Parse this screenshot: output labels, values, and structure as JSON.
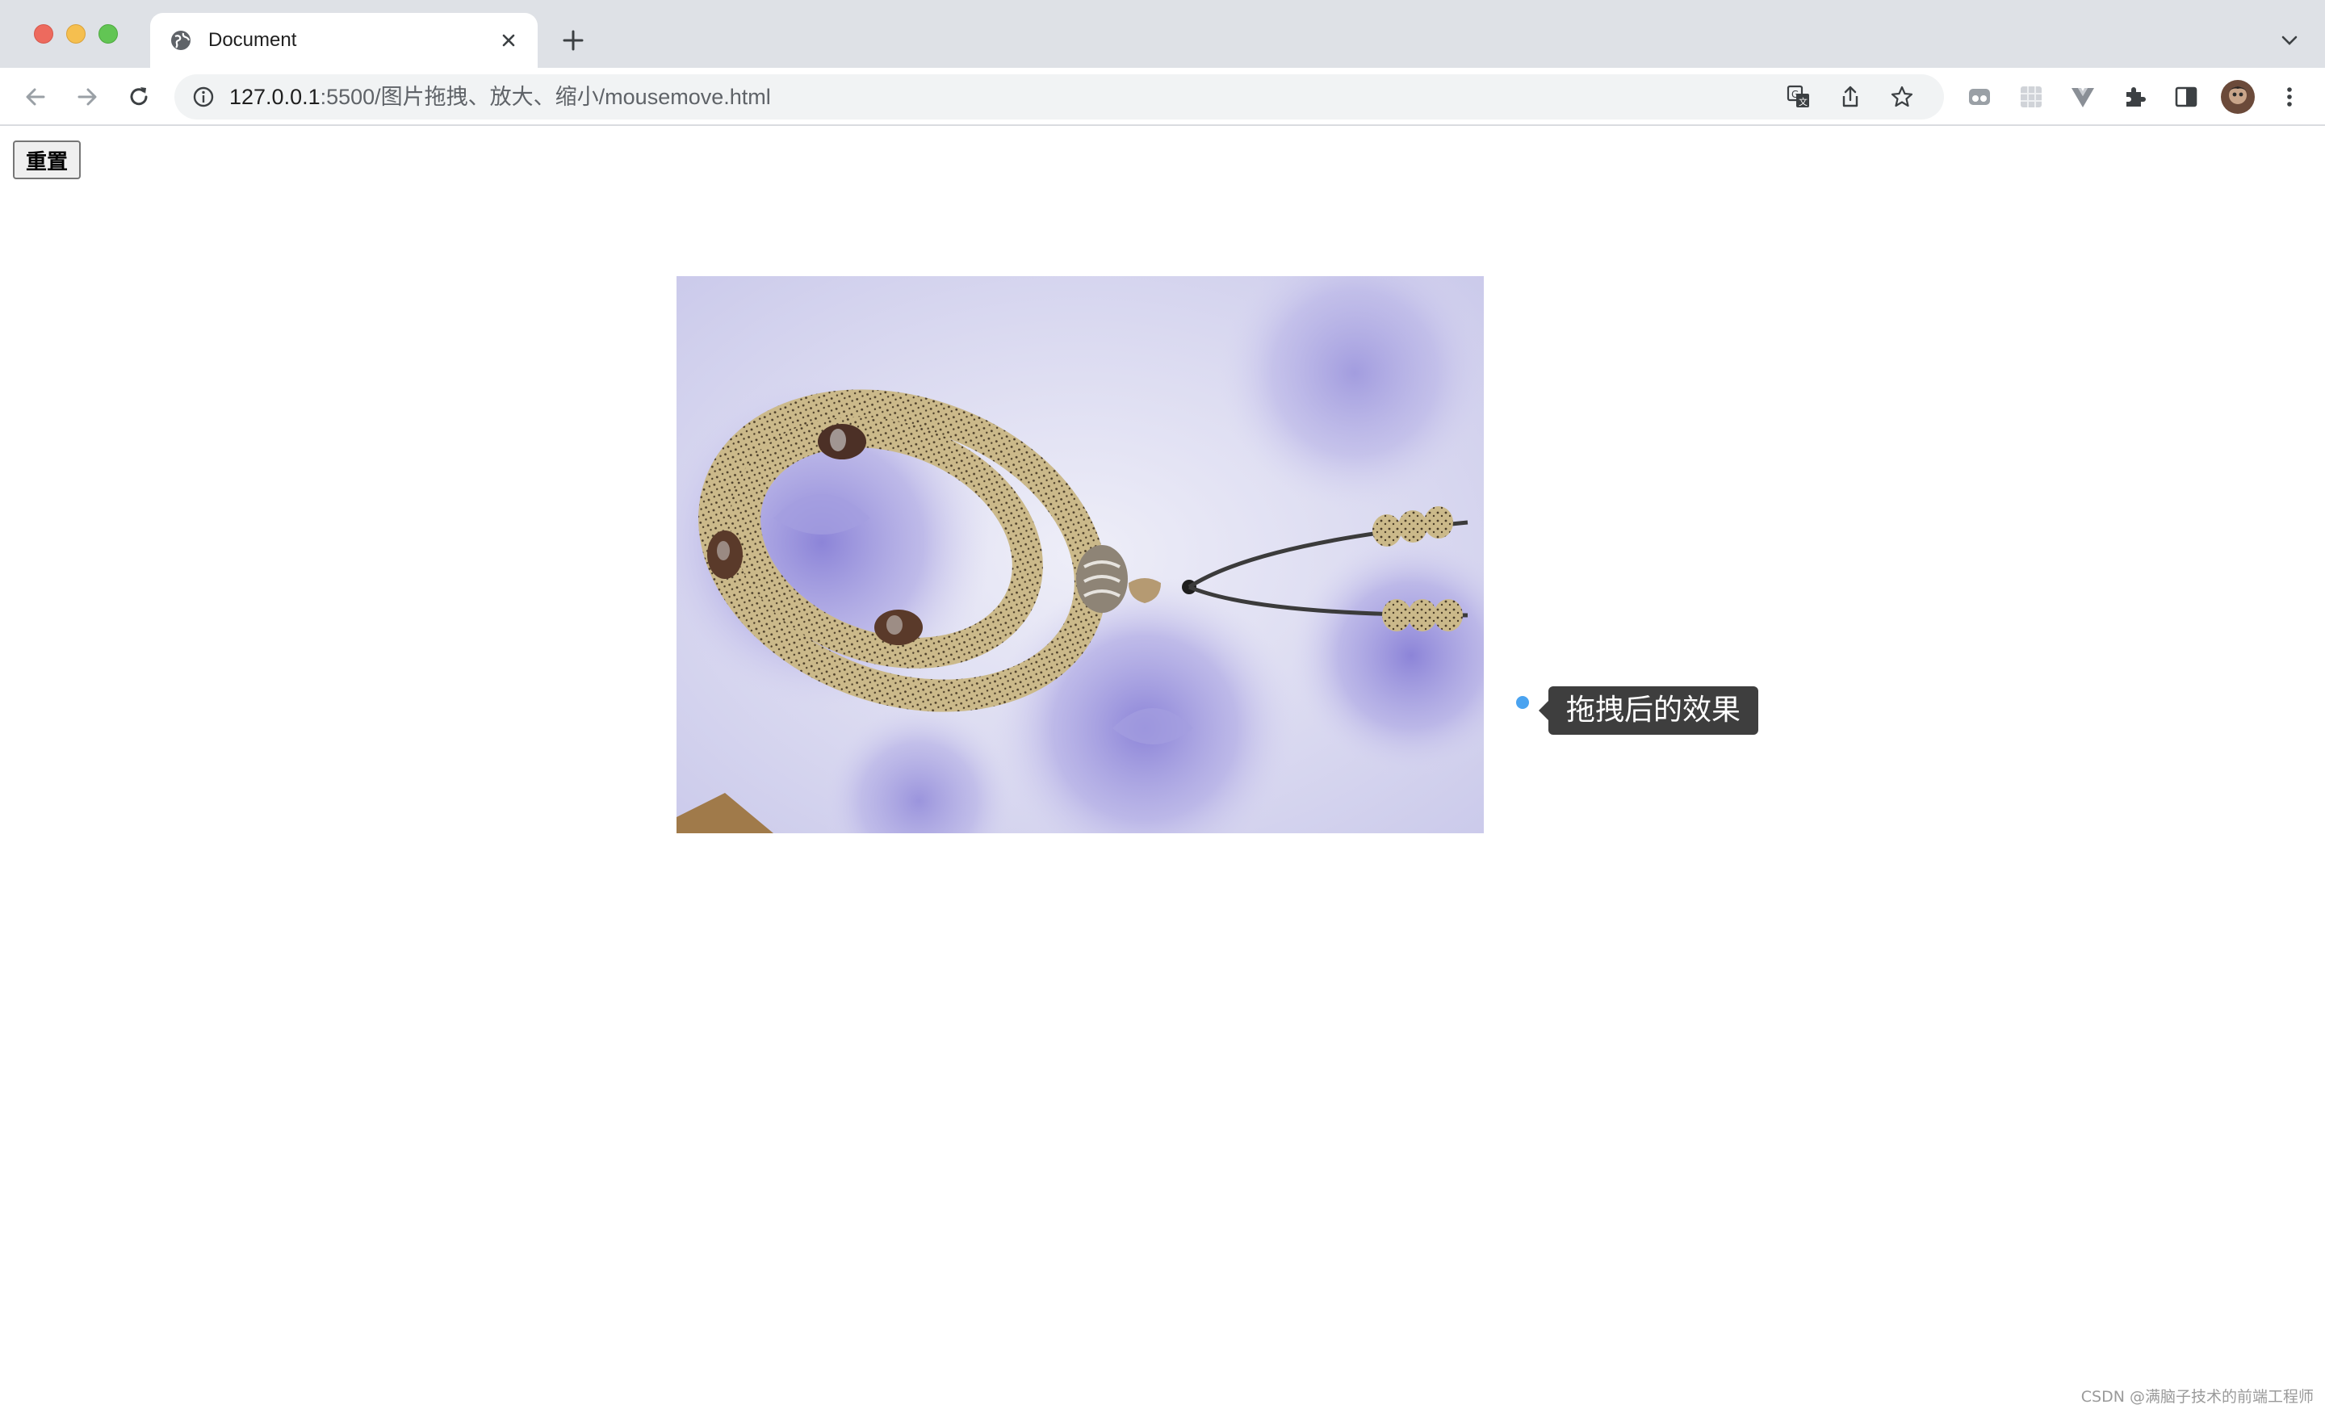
{
  "browser": {
    "tab_title": "Document",
    "url_host": "127.0.0.1",
    "url_path": ":5500/图片拖拽、放大、缩小/mousemove.html"
  },
  "page": {
    "reset_label": "重置",
    "tooltip_text": "拖拽后的效果",
    "image_alt_icon": "bead-bracelet-photo"
  },
  "watermark": "CSDN @满脑子技术的前端工程师",
  "colors": {
    "tab_strip": "#dee1e6",
    "tooltip_bg": "#3e3e3e",
    "dot": "#4aa3f0"
  }
}
